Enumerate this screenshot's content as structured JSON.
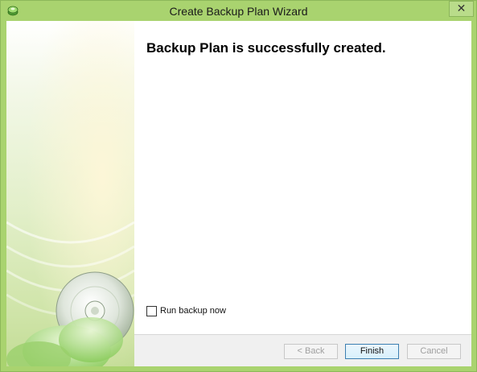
{
  "window": {
    "title": "Create Backup Plan Wizard",
    "close_glyph": "✕",
    "icon": "backup-disc-icon"
  },
  "content": {
    "heading": "Backup Plan is successfully created.",
    "run_backup_label": "Run backup now",
    "run_backup_checked": false
  },
  "footer": {
    "back_label": "< Back",
    "finish_label": "Finish",
    "cancel_label": "Cancel"
  },
  "colors": {
    "title_bar": "#a9d36f",
    "side_panel": "#cfe4a8",
    "default_button_border": "#3c7fb1"
  }
}
